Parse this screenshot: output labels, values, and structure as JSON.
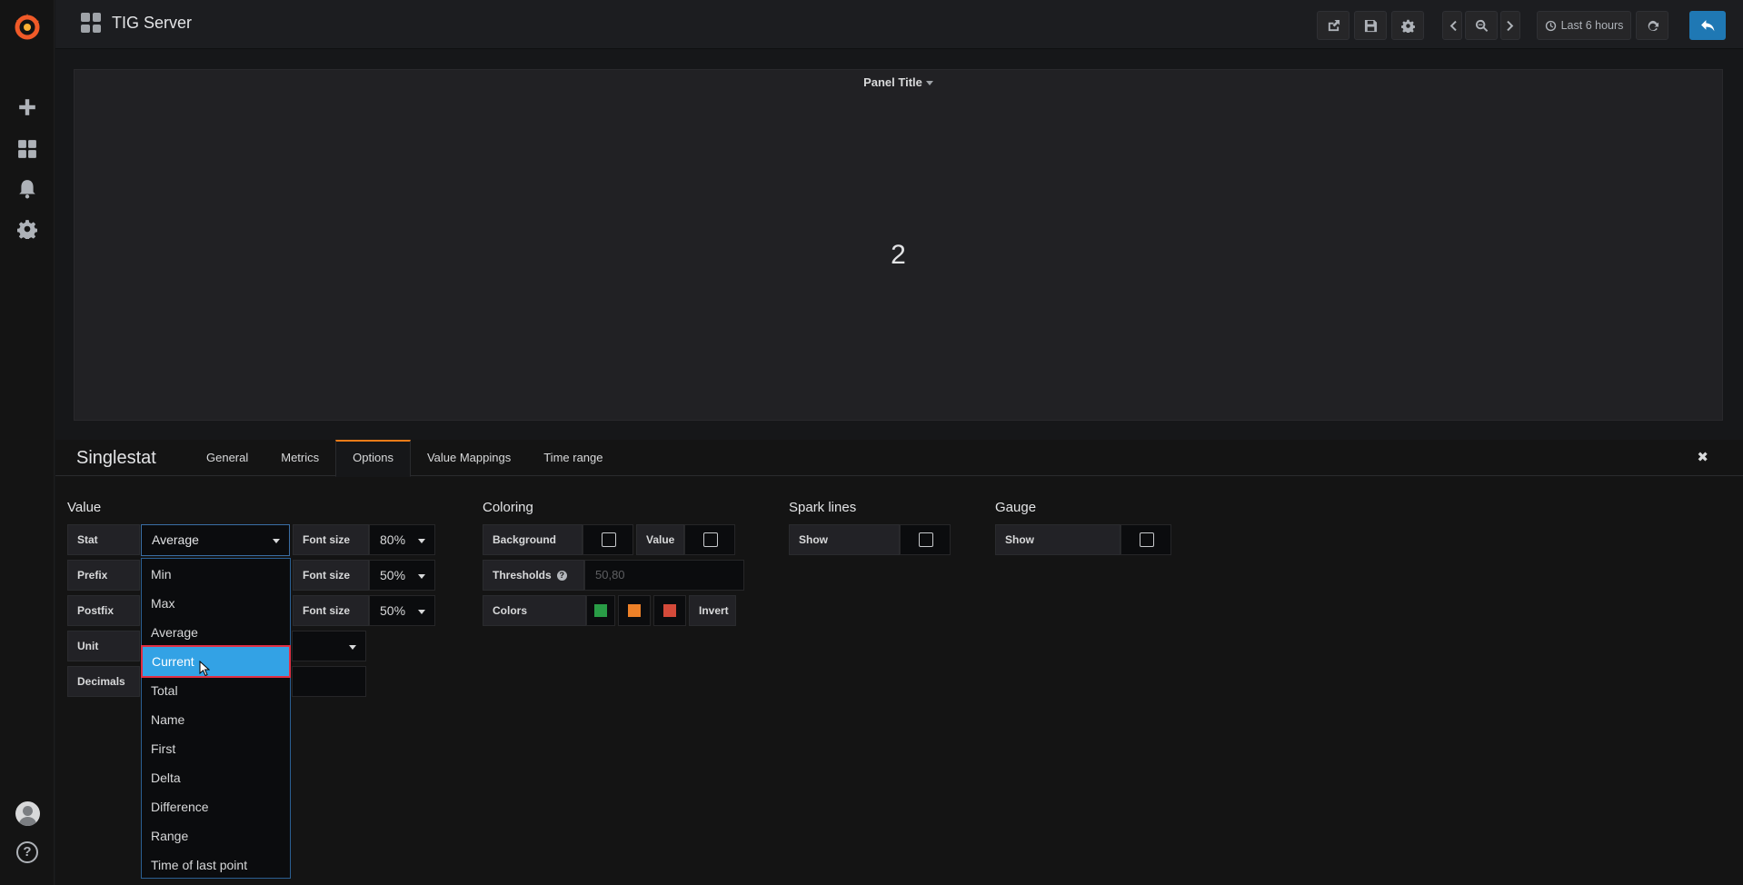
{
  "app": {
    "dashboard_title": "TIG Server",
    "accent_color": "#eb7b18",
    "primary_color": "#1f78b4",
    "highlight_color": "#33a2e5"
  },
  "sidemenu": {
    "icons": [
      "grafana-logo-icon",
      "plus-icon",
      "dashboards-grid-icon",
      "bell-icon",
      "gear-icon",
      "avatar",
      "help-icon"
    ],
    "help_glyph": "?"
  },
  "navbar": {
    "time_range": "Last 6 hours"
  },
  "panel": {
    "title": "Panel Title",
    "value": "2"
  },
  "editor": {
    "title": "Singlestat",
    "tabs": [
      "General",
      "Metrics",
      "Options",
      "Value Mappings",
      "Time range"
    ],
    "active_tab": "Options",
    "close_glyph": "✖"
  },
  "options": {
    "value": {
      "section_title": "Value",
      "stat_label": "Stat",
      "stat_selected": "Average",
      "prefix_label": "Prefix",
      "postfix_label": "Postfix",
      "unit_label": "Unit",
      "decimals_label": "Decimals",
      "font_size_label": "Font size",
      "value_font_size": "80%",
      "prefix_font_size": "50%",
      "postfix_font_size": "50%"
    },
    "stat_dropdown": {
      "items": [
        "Min",
        "Max",
        "Average",
        "Current",
        "Total",
        "Name",
        "First",
        "Delta",
        "Difference",
        "Range",
        "Time of last point"
      ],
      "highlighted": "Current"
    },
    "coloring": {
      "section_title": "Coloring",
      "background_label": "Background",
      "value_label": "Value",
      "thresholds_label": "Thresholds",
      "thresholds_placeholder": "50,80",
      "colors_label": "Colors",
      "color_swatches": [
        "#299c46",
        "#ed8128",
        "#d44a3a"
      ],
      "invert_label": "Invert"
    },
    "spark_lines": {
      "section_title": "Spark lines",
      "show_label": "Show"
    },
    "gauge": {
      "section_title": "Gauge",
      "show_label": "Show"
    }
  }
}
